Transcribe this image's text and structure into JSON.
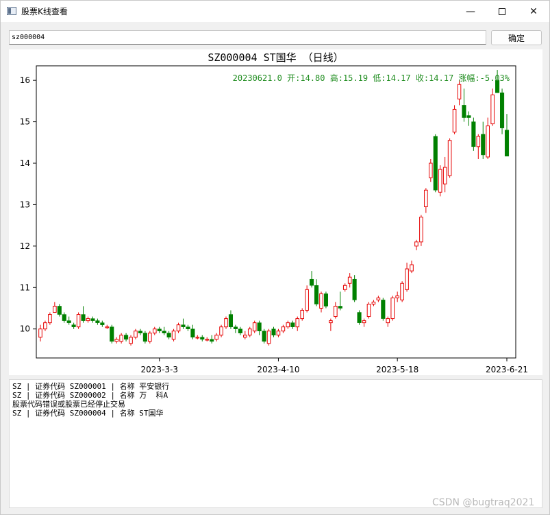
{
  "window": {
    "title": "股票K线查看",
    "icons": {
      "app": "window-icon",
      "minimize": "minimize-icon",
      "maximize": "maximize-icon",
      "close": "close-icon"
    }
  },
  "search": {
    "value": "sz000004",
    "button_label": "确定"
  },
  "chart": {
    "title": "SZ000004 ST国华 （日线）",
    "info": "20230621.0 开:14.80 高:15.19 低:14.17 收:14.17 涨幅:-5.03%",
    "up_color": "#e60000",
    "down_color": "#008000",
    "info_color": "#1e8c1e"
  },
  "chart_data": {
    "type": "candlestick",
    "title": "SZ000004 ST国华 （日线）",
    "y_ticks": [
      10,
      11,
      12,
      13,
      14,
      15,
      16
    ],
    "x_ticks": [
      "2023-3-3",
      "2023-4-10",
      "2023-5-18",
      "2023-6-21"
    ],
    "ylim": [
      9.3,
      16.35
    ],
    "grid": false,
    "candles": [
      [
        9.8,
        10.1,
        9.7,
        10.0
      ],
      [
        10.0,
        10.2,
        9.95,
        10.15
      ],
      [
        10.15,
        10.4,
        10.1,
        10.35
      ],
      [
        10.4,
        10.65,
        10.4,
        10.55
      ],
      [
        10.55,
        10.6,
        10.3,
        10.35
      ],
      [
        10.35,
        10.4,
        10.15,
        10.2
      ],
      [
        10.2,
        10.3,
        10.1,
        10.15
      ],
      [
        10.1,
        10.15,
        10.0,
        10.05
      ],
      [
        10.05,
        10.4,
        10.0,
        10.35
      ],
      [
        10.35,
        10.55,
        10.15,
        10.2
      ],
      [
        10.2,
        10.3,
        10.15,
        10.25
      ],
      [
        10.25,
        10.3,
        10.15,
        10.2
      ],
      [
        10.2,
        10.25,
        10.1,
        10.15
      ],
      [
        10.15,
        10.2,
        10.05,
        10.1
      ],
      [
        10.05,
        10.1,
        10.0,
        10.05
      ],
      [
        10.05,
        10.1,
        9.65,
        9.7
      ],
      [
        9.7,
        9.8,
        9.65,
        9.75
      ],
      [
        9.7,
        9.9,
        9.65,
        9.85
      ],
      [
        9.85,
        9.9,
        9.7,
        9.75
      ],
      [
        9.65,
        9.85,
        9.6,
        9.8
      ],
      [
        9.8,
        10.0,
        9.75,
        9.95
      ],
      [
        9.95,
        10.0,
        9.85,
        9.9
      ],
      [
        9.9,
        9.95,
        9.65,
        9.7
      ],
      [
        9.7,
        9.95,
        9.65,
        9.9
      ],
      [
        9.9,
        10.05,
        9.85,
        10.0
      ],
      [
        10.0,
        10.05,
        9.9,
        9.95
      ],
      [
        9.95,
        10.05,
        9.85,
        9.9
      ],
      [
        9.9,
        9.95,
        9.75,
        9.8
      ],
      [
        9.75,
        10.0,
        9.7,
        9.95
      ],
      [
        9.95,
        10.15,
        9.9,
        10.1
      ],
      [
        10.1,
        10.25,
        10.0,
        10.05
      ],
      [
        10.05,
        10.1,
        9.95,
        10.0
      ],
      [
        10.0,
        10.1,
        9.75,
        9.8
      ],
      [
        9.8,
        9.85,
        9.75,
        9.8
      ],
      [
        9.8,
        9.85,
        9.7,
        9.75
      ],
      [
        9.75,
        9.8,
        9.7,
        9.75
      ],
      [
        9.75,
        9.85,
        9.65,
        9.7
      ],
      [
        9.75,
        9.9,
        9.7,
        9.85
      ],
      [
        9.85,
        10.1,
        9.8,
        10.05
      ],
      [
        10.05,
        10.3,
        10.0,
        10.25
      ],
      [
        10.35,
        10.45,
        10.0,
        10.05
      ],
      [
        10.05,
        10.1,
        9.9,
        10.0
      ],
      [
        10.0,
        10.05,
        9.85,
        9.9
      ],
      [
        9.8,
        9.95,
        9.75,
        9.85
      ],
      [
        9.85,
        10.05,
        9.8,
        10.0
      ],
      [
        9.95,
        10.2,
        9.9,
        10.15
      ],
      [
        10.15,
        10.2,
        9.85,
        9.95
      ],
      [
        9.95,
        10.0,
        9.65,
        9.7
      ],
      [
        9.65,
        10.0,
        9.6,
        9.95
      ],
      [
        10.0,
        10.05,
        9.8,
        9.85
      ],
      [
        9.85,
        10.0,
        9.8,
        9.95
      ],
      [
        9.95,
        10.1,
        9.9,
        10.05
      ],
      [
        10.05,
        10.2,
        10.0,
        10.15
      ],
      [
        10.15,
        10.2,
        10.0,
        10.05
      ],
      [
        10.05,
        10.3,
        9.95,
        10.25
      ],
      [
        10.25,
        10.5,
        10.2,
        10.45
      ],
      [
        10.45,
        11.05,
        10.4,
        10.95
      ],
      [
        11.2,
        11.4,
        11.0,
        11.05
      ],
      [
        11.05,
        11.2,
        10.55,
        10.6
      ],
      [
        10.5,
        10.9,
        10.4,
        10.85
      ],
      [
        10.85,
        10.9,
        10.5,
        10.55
      ],
      [
        10.15,
        10.25,
        9.95,
        10.2
      ],
      [
        10.3,
        10.65,
        10.25,
        10.55
      ],
      [
        10.55,
        10.9,
        10.45,
        10.5
      ],
      [
        10.95,
        11.1,
        10.9,
        11.05
      ],
      [
        11.1,
        11.35,
        11.0,
        11.25
      ],
      [
        11.2,
        11.3,
        10.65,
        10.7
      ],
      [
        10.4,
        10.45,
        10.1,
        10.15
      ],
      [
        10.15,
        10.25,
        10.05,
        10.2
      ],
      [
        10.3,
        10.65,
        10.25,
        10.6
      ],
      [
        10.6,
        10.7,
        10.55,
        10.65
      ],
      [
        10.7,
        10.8,
        10.65,
        10.75
      ],
      [
        10.7,
        10.75,
        10.2,
        10.25
      ],
      [
        10.15,
        10.3,
        10.05,
        10.25
      ],
      [
        10.25,
        10.8,
        10.2,
        10.75
      ],
      [
        10.75,
        10.9,
        10.65,
        10.8
      ],
      [
        10.7,
        11.15,
        10.65,
        11.1
      ],
      [
        10.95,
        11.6,
        10.9,
        11.45
      ],
      [
        11.4,
        11.65,
        11.35,
        11.55
      ],
      [
        12.0,
        12.15,
        11.9,
        12.1
      ],
      [
        12.1,
        12.75,
        12.0,
        12.7
      ],
      [
        12.95,
        13.4,
        12.8,
        13.35
      ],
      [
        13.65,
        14.1,
        13.55,
        14.0
      ],
      [
        14.65,
        14.7,
        13.3,
        13.35
      ],
      [
        13.3,
        13.95,
        13.2,
        13.85
      ],
      [
        13.5,
        14.15,
        13.3,
        13.9
      ],
      [
        13.7,
        14.6,
        13.65,
        14.55
      ],
      [
        14.75,
        15.4,
        14.7,
        15.3
      ],
      [
        15.55,
        16.0,
        15.4,
        15.9
      ],
      [
        15.4,
        15.8,
        15.0,
        15.1
      ],
      [
        15.15,
        15.25,
        14.9,
        15.1
      ],
      [
        15.0,
        15.1,
        14.3,
        14.4
      ],
      [
        14.4,
        14.7,
        14.1,
        14.65
      ],
      [
        14.7,
        15.0,
        14.1,
        14.2
      ],
      [
        14.15,
        15.1,
        14.1,
        14.9
      ],
      [
        14.95,
        15.8,
        14.9,
        15.65
      ],
      [
        16.0,
        16.25,
        15.75,
        15.7
      ],
      [
        15.7,
        15.8,
        14.7,
        14.85
      ],
      [
        14.8,
        15.19,
        14.17,
        14.17
      ]
    ]
  },
  "log": {
    "lines": [
      "SZ | 证券代码 SZ000001 | 名称 平安银行",
      "SZ | 证券代码 SZ000002 | 名称 万  科A",
      "股票代码错误或股票已经停止交易",
      "SZ | 证券代码 SZ000004 | 名称 ST国华"
    ]
  },
  "watermark": "CSDN @bugtraq2021"
}
